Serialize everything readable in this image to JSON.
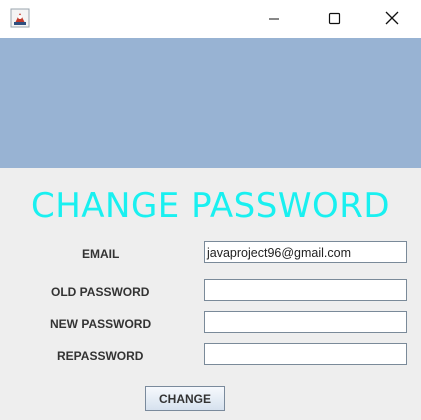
{
  "window": {
    "app_icon": "java-cup-icon",
    "controls": {
      "minimize": "minimize-icon",
      "maximize": "maximize-icon",
      "close": "close-icon"
    }
  },
  "banner_color": "#98b3d3",
  "heading": {
    "text": "CHANGE PASSWORD",
    "color": "#19f0f0"
  },
  "form": {
    "email_label": "EMAIL",
    "email_value": "javaproject96@gmail.com",
    "old_password_label": "OLD PASSWORD",
    "old_password_value": "",
    "new_password_label": "NEW PASSWORD",
    "new_password_value": "",
    "repassword_label": "REPASSWORD",
    "repassword_value": ""
  },
  "change_button_label": "CHANGE"
}
